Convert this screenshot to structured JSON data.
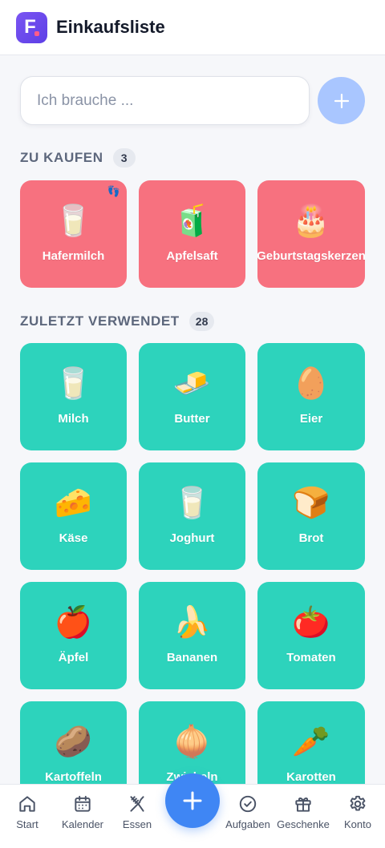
{
  "header": {
    "logo_letter": "F",
    "title": "Einkaufsliste"
  },
  "add_item": {
    "placeholder": "Ich brauche ...",
    "value": "",
    "button_icon": "plus-icon"
  },
  "to_buy": {
    "title": "ZU KAUFEN",
    "count": "3",
    "items": [
      {
        "label": "Hafermilch",
        "emoji": "🥛",
        "has_badge": true,
        "badge_icon": "footprints-icon",
        "badge_glyph": "👣"
      },
      {
        "label": "Apfelsaft",
        "emoji": "🧃"
      },
      {
        "label": "Geburtstagskerzen",
        "emoji": "🎂"
      }
    ]
  },
  "recent": {
    "title": "ZULETZT VERWENDET",
    "count": "28",
    "items": [
      {
        "label": "Milch",
        "emoji": "🥛"
      },
      {
        "label": "Butter",
        "emoji": "🧈"
      },
      {
        "label": "Eier",
        "emoji": "🥚"
      },
      {
        "label": "Käse",
        "emoji": "🧀"
      },
      {
        "label": "Joghurt",
        "emoji": "🥛"
      },
      {
        "label": "Brot",
        "emoji": "🍞"
      },
      {
        "label": "Äpfel",
        "emoji": "🍎"
      },
      {
        "label": "Bananen",
        "emoji": "🍌"
      },
      {
        "label": "Tomaten",
        "emoji": "🍅"
      },
      {
        "label": "Kartoffeln",
        "emoji": "🥔"
      },
      {
        "label": "Zwiebeln",
        "emoji": "🧅"
      },
      {
        "label": "Karotten",
        "emoji": "🥕"
      }
    ]
  },
  "nav": {
    "items": [
      {
        "label": "Start",
        "icon": "home-icon"
      },
      {
        "label": "Kalender",
        "icon": "calendar-icon"
      },
      {
        "label": "Essen",
        "icon": "utensils-icon"
      },
      {
        "label": "Aufgaben",
        "icon": "check-circle-icon"
      },
      {
        "label": "Geschenke",
        "icon": "gift-icon"
      },
      {
        "label": "Konto",
        "icon": "gear-icon"
      }
    ],
    "fab_icon": "plus-icon"
  },
  "colors": {
    "to_buy_tile": "#f7717f",
    "recent_tile": "#2dd3bc",
    "accent": "#3f86f4",
    "logo": "#6a48ec"
  }
}
